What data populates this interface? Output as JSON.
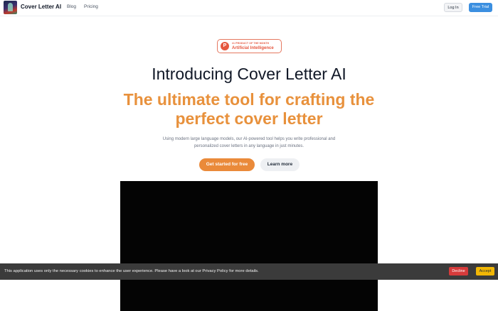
{
  "header": {
    "brand": "Cover Letter AI",
    "logo_icon": "cover-letter-ai-logo",
    "nav": [
      {
        "label": "Blog"
      },
      {
        "label": "Pricing"
      }
    ],
    "login_label": "Log In",
    "trial_label": "Free Trial"
  },
  "badge": {
    "icon_letter": "P",
    "top_text": "#1 PRODUCT OF THE MONTH",
    "main_text": "Artificial Intelligence"
  },
  "hero": {
    "title": "Introducing Cover Letter AI",
    "subtitle": "The ultimate tool for crafting the perfect cover letter",
    "description": "Using modern large language models, our AI-powered tool helps you write professional and personalized cover letters in any language in just minutes.",
    "primary_cta": "Get started for free",
    "secondary_cta": "Learn more"
  },
  "cookie": {
    "message": "This application uses only the necessary cookies to enhance the user experience. Please have a look at our Privacy Policy for more details.",
    "decline_label": "Decline",
    "accept_label": "Accept"
  },
  "colors": {
    "accent_orange": "#e8913c",
    "primary_blue": "#3b8fe0",
    "product_hunt_red": "#e5573f",
    "decline_red": "#d63b3b",
    "accept_yellow": "#f2b705"
  }
}
